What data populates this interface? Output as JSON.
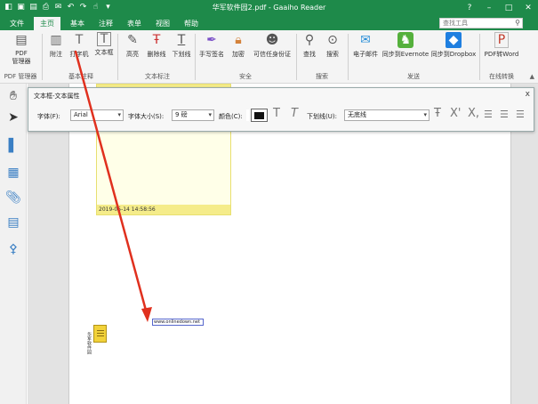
{
  "window": {
    "title": "华军软件园2.pdf - Gaaiho Reader",
    "controls": [
      "?",
      "–",
      "□",
      "✕"
    ]
  },
  "menu": {
    "tabs": [
      "文件",
      "主页",
      "基本",
      "注释",
      "表单",
      "视图",
      "帮助"
    ],
    "active": "主页",
    "search_placeholder": "查找工具"
  },
  "ribbon": {
    "buttons": {
      "pdf_manager": "PDF\n管理器",
      "note": "附注",
      "typewriter": "打字机",
      "textbox": "文本框",
      "highlight": "高亮",
      "strikeout": "删除线",
      "underline": "下划线",
      "sign": "手写签名",
      "encrypt": "加密",
      "trusted_id": "可信任身份证",
      "find": "查找",
      "search": "搜索",
      "email": "电子邮件",
      "evernote": "同步到Evernote",
      "dropbox": "同步到Dropbox",
      "pdf_to_word": "PDF转Word"
    },
    "groups": {
      "pdf_manager": "PDF 管理器",
      "basic_comment": "基本注释",
      "text_markup": "文本标注",
      "security": "安全",
      "search": "搜索",
      "send": "发送",
      "online": "在线转换"
    }
  },
  "textbox_toolbar": {
    "title": "文本框-文本属性",
    "font_label": "字体(F):",
    "font_value": "Arial",
    "size_label": "字体大小(S):",
    "size_value": "9 磅",
    "color_label": "颜色(C):",
    "underline_label": "下划线(U):",
    "underline_value": "无底线",
    "close": "x"
  },
  "document": {
    "note_timestamp": "2019-05-14 14:58:56",
    "url_text": "www.onlinedown.net",
    "vertical_text": "华军软件园"
  },
  "colors": {
    "accent": "#1e8a4a",
    "note_yellow": "#f5ec8a",
    "arrow": "#e0301e"
  }
}
